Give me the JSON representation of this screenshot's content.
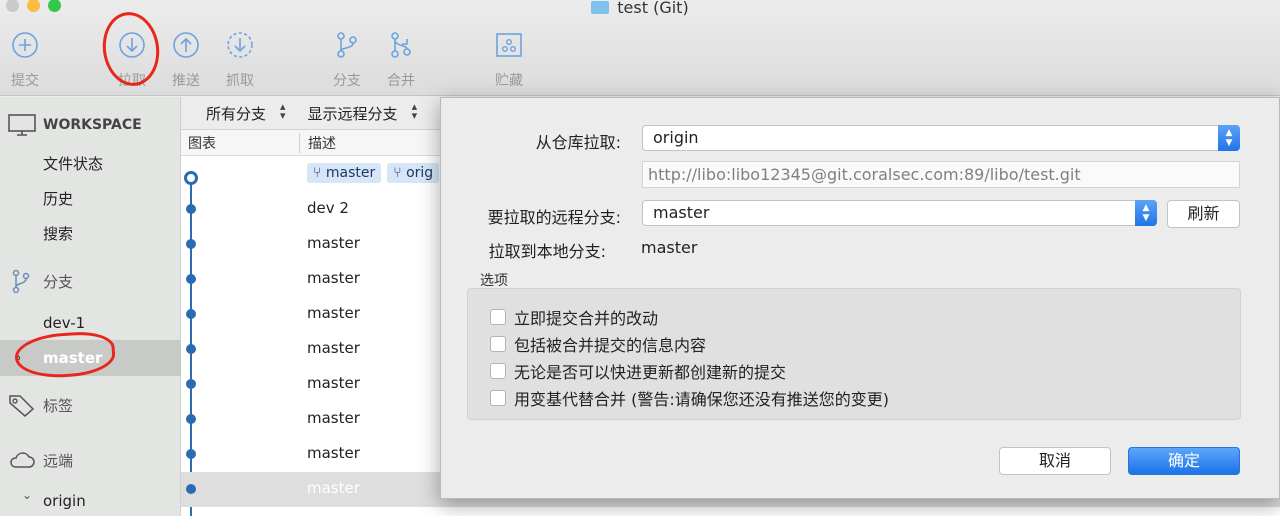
{
  "window": {
    "title": "test (Git)"
  },
  "toolbar": [
    {
      "label": "提交",
      "icon": "plus-circle-icon"
    },
    {
      "label": "拉取",
      "icon": "arrow-down-circle-icon"
    },
    {
      "label": "推送",
      "icon": "arrow-up-circle-icon"
    },
    {
      "label": "抓取",
      "icon": "dashed-arrow-down-circle-icon"
    },
    {
      "label": "分支",
      "icon": "branch-icon"
    },
    {
      "label": "合并",
      "icon": "merge-icon"
    },
    {
      "label": "贮藏",
      "icon": "stash-icon"
    }
  ],
  "sidebar": {
    "workspace": "WORKSPACE",
    "workspace_items": [
      "文件状态",
      "历史",
      "搜索"
    ],
    "branches_header": "分支",
    "branches": [
      "dev-1",
      "master"
    ],
    "tags_header": "标签",
    "remotes_header": "远端",
    "remotes": [
      "origin"
    ],
    "remote_chevron": "⌄"
  },
  "list": {
    "branch_filter": "所有分支",
    "remote_filter": "显示远程分支",
    "col_graph": "图表",
    "col_desc": "描述",
    "tags": [
      "master",
      "orig"
    ],
    "rows": [
      "",
      "dev 2",
      "master",
      "master",
      "master",
      "master",
      "master",
      "master",
      "master",
      "master"
    ]
  },
  "dialog": {
    "from_repo_label": "从仓库拉取:",
    "from_repo_value": "origin",
    "url": "http://libo:libo12345@git.coralsec.com:89/libo/test.git",
    "remote_branch_label": "要拉取的远程分支:",
    "remote_branch_value": "master",
    "refresh_button": "刷新",
    "local_branch_label": "拉取到本地分支:",
    "local_branch_value": "master",
    "options_title": "选项",
    "options": [
      "立即提交合并的改动",
      "包括被合并提交的信息内容",
      "无论是否可以快进更新都创建新的提交",
      "用变基代替合并 (警告:请确保您还没有推送您的变更)"
    ],
    "cancel_button": "取消",
    "ok_button": "确定"
  },
  "colors": {
    "accent": "#1f74e8",
    "graph": "#2c6ab2",
    "annotation": "#e8261b"
  }
}
